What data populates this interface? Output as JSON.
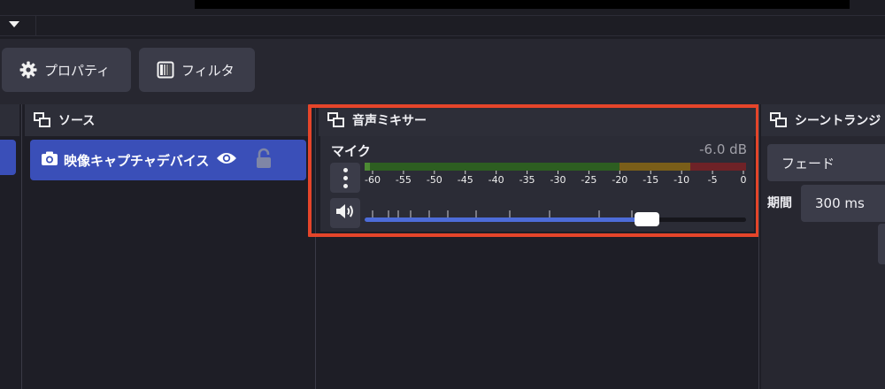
{
  "toolbar": {
    "properties_label": "プロパティ",
    "filters_label": "フィルタ",
    "properties_icon": "gear-icon",
    "filters_icon": "filter-icon"
  },
  "sources": {
    "title": "ソース",
    "items": [
      {
        "label": "映像キャプチャデバイス",
        "icon": "camera-icon",
        "visible": true,
        "locked": false
      }
    ]
  },
  "mixer": {
    "title": "音声ミキサー",
    "channel": {
      "name": "マイク",
      "db": "-6.0 dB",
      "meter_labels": [
        "-60",
        "-55",
        "-50",
        "-45",
        "-40",
        "-35",
        "-30",
        "-25",
        "-20",
        "-15",
        "-10",
        "-5",
        "0"
      ],
      "meter_level_db": -60,
      "volume_fraction": 0.74
    },
    "colors": {
      "highlight": "#e5452a",
      "meter_green": "#2d5e21",
      "meter_yellow": "#7a5e19",
      "meter_red": "#6e2227",
      "slider_fill": "#4d6cd8"
    }
  },
  "transitions": {
    "title": "シーントランジ",
    "selected": "フェード",
    "duration_label": "期間",
    "duration_value": "300 ms"
  },
  "colors": {
    "accent": "#3a4fb8",
    "background": "#1e1e26",
    "panel": "#272730",
    "button": "#3b3c49"
  }
}
